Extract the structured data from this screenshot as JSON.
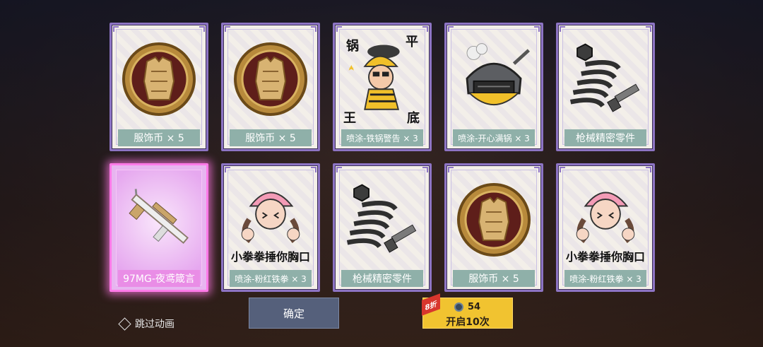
{
  "cards": [
    {
      "label": "服饰币 × 5",
      "icon": "armor-coin-icon"
    },
    {
      "label": "服饰币 × 5",
      "icon": "armor-coin-icon"
    },
    {
      "label": "喷涂-铁锅警告 × 3",
      "icon": "spray-pan-warning-icon",
      "art_text": [
        "锅",
        "平",
        "王",
        "底"
      ]
    },
    {
      "label": "喷涂-开心满锅 × 3",
      "icon": "spray-happy-pan-icon"
    },
    {
      "label": "枪械精密零件",
      "icon": "spring-bolt-icon"
    },
    {
      "label": "97MG-夜鸢箴言",
      "icon": "rifle-skin-icon"
    },
    {
      "label": "喷涂-粉红铁拳 × 3",
      "icon": "spray-pink-fist-icon",
      "art_text": [
        "小拳拳捶你胸口"
      ]
    },
    {
      "label": "枪械精密零件",
      "icon": "spring-bolt-icon"
    },
    {
      "label": "服饰币 × 5",
      "icon": "armor-coin-icon"
    },
    {
      "label": "喷涂-粉红铁拳 × 3",
      "icon": "spray-pink-fist-icon",
      "art_text": [
        "小拳拳捶你胸口"
      ]
    }
  ],
  "skip": {
    "label": "跳过动画"
  },
  "confirm": {
    "label": "确定"
  },
  "open": {
    "badge": "8折",
    "cost": "54",
    "label": "开启10次"
  },
  "colors": {
    "card_border": "#8d74c4",
    "label_bg": "#8fb0a9",
    "highlight": "#ff7ae8",
    "open_button": "#f1c330"
  }
}
